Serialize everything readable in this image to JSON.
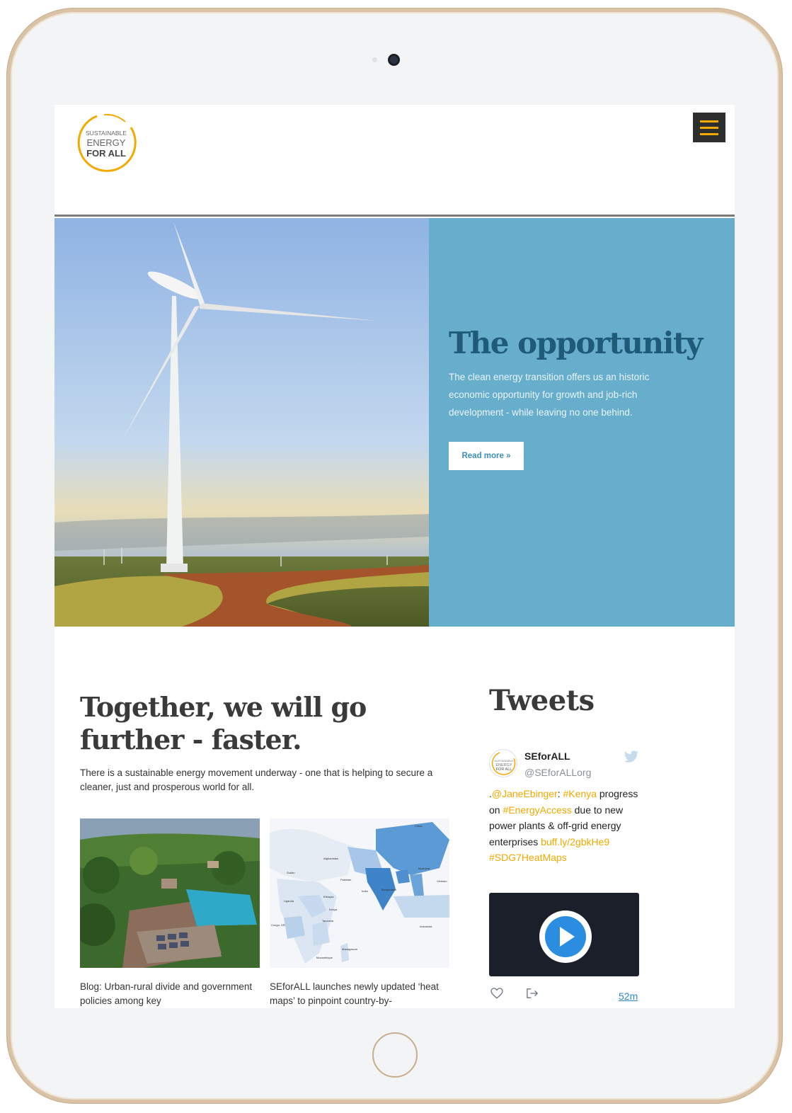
{
  "header": {
    "logo_text": [
      "SUSTAINABLE",
      "ENERGY",
      "FOR ALL"
    ],
    "menu_icon": "hamburger-menu-icon",
    "accent_color": "#f2a900"
  },
  "hero": {
    "title": "The opportunity",
    "text": "The clean energy transition offers us an historic economic opportunity for growth and job-rich development - while leaving no one behind.",
    "button_label": "Read more »",
    "panel_color": "#67aecd"
  },
  "main": {
    "heading": "Together, we will go further - faster.",
    "intro": "There is a sustainable energy movement underway - one that is helping to secure a cleaner, just and prosperous world for all.",
    "cards": [
      {
        "caption": "Blog: Urban-rural divide and government policies among key"
      },
      {
        "caption": "SEforALL launches newly updated ‘heat maps’ to pinpoint country-by-",
        "map_labels": [
          "China",
          "Afghanistan",
          "Pakistan",
          "India",
          "Bangladesh",
          "Myanmar",
          "Vietnam",
          "Sudan",
          "Ethiopia",
          "Uganda",
          "Kenya",
          "Tanzania",
          "Congo, DR",
          "Mozambique",
          "Madagascar",
          "Indonesia"
        ]
      }
    ]
  },
  "tweets": {
    "heading": "Tweets",
    "name": "SEforALL",
    "handle": "@SEforALLorg",
    "body": {
      "prefix": ".",
      "mention": "@JaneEbinger",
      "colon": ": ",
      "tag1": "#Kenya",
      "text1": " progress on ",
      "tag2": "#EnergyAccess",
      "text2": " due to new power plants & off-grid energy enterprises ",
      "link": "buff.ly/2gbkHe9",
      "tag3": "#SDG7HeatMaps"
    },
    "time": "52m",
    "highlight_color": "#f0a800"
  }
}
